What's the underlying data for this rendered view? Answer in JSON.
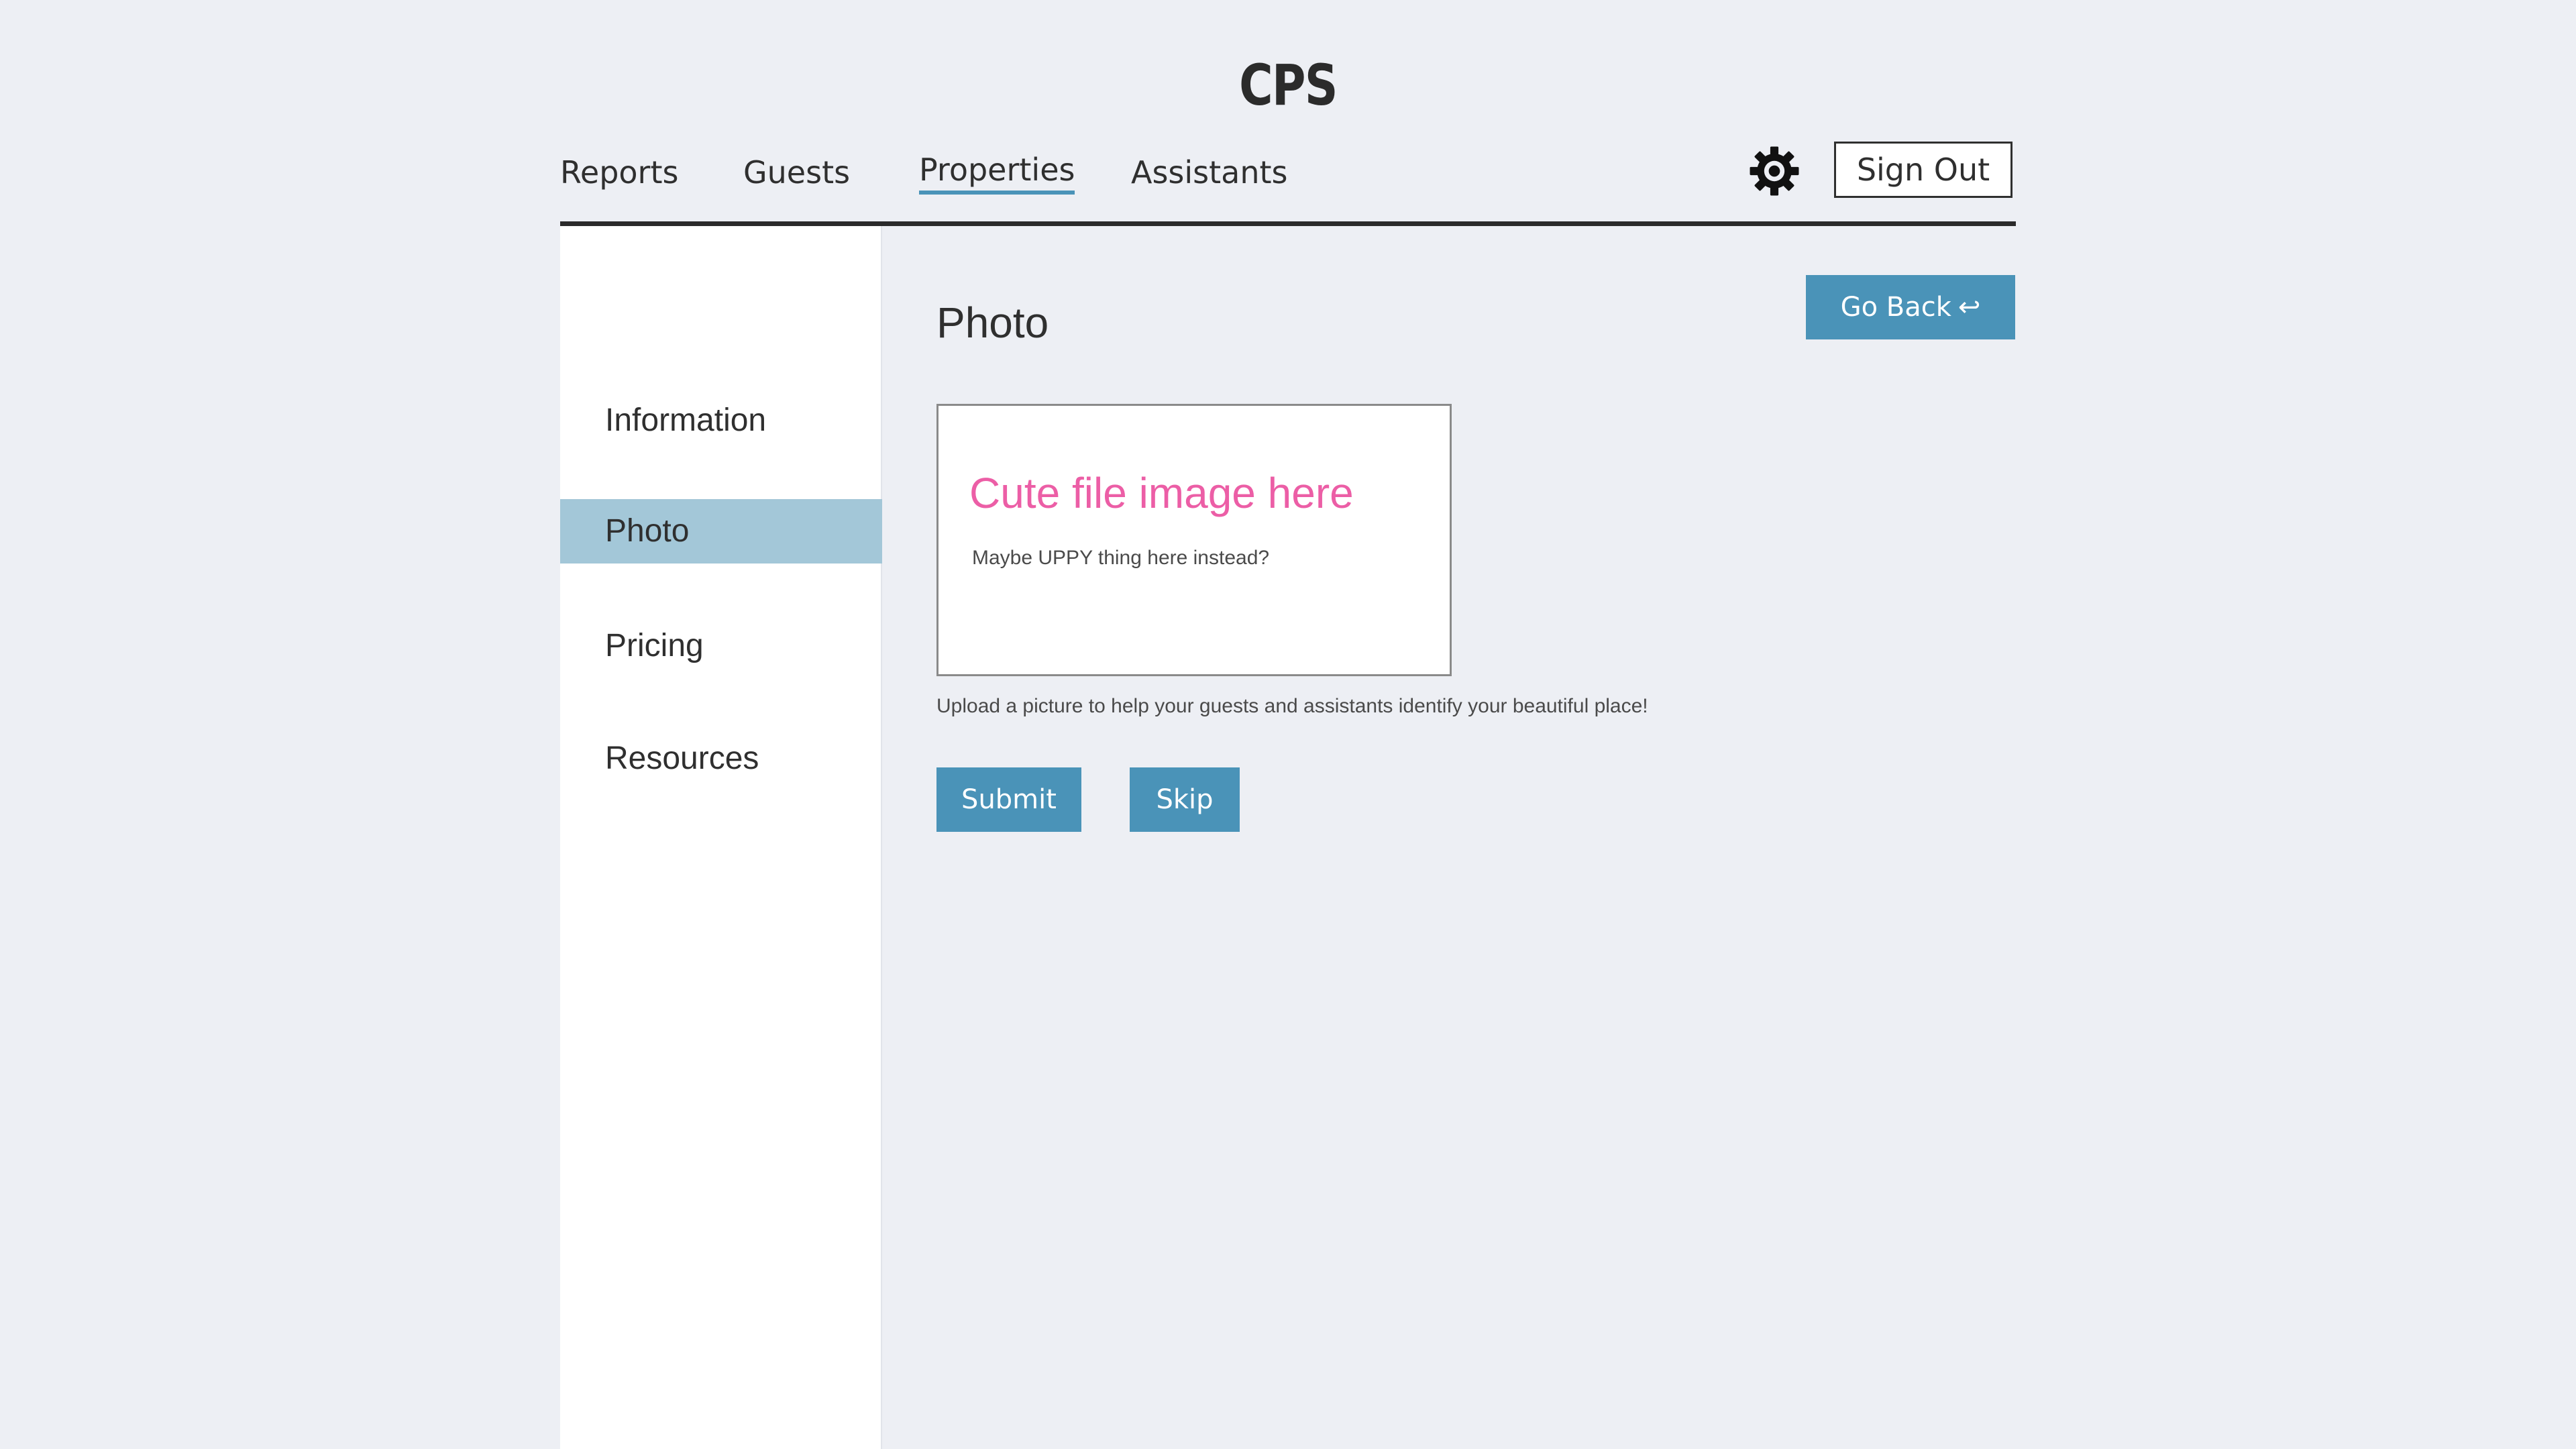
{
  "app": {
    "title": "CPS"
  },
  "nav": {
    "items": [
      {
        "label": "Reports"
      },
      {
        "label": "Guests"
      },
      {
        "label": "Properties",
        "active": true
      },
      {
        "label": "Assistants"
      }
    ],
    "settings_icon": "gear-icon",
    "sign_out_label": "Sign Out"
  },
  "sidebar": {
    "items": [
      {
        "label": "Information"
      },
      {
        "label": "Photo",
        "active": true
      },
      {
        "label": "Pricing"
      },
      {
        "label": "Resources"
      }
    ]
  },
  "main": {
    "title": "Photo",
    "go_back_label": "Go Back",
    "go_back_icon": "return-arrow-icon",
    "dropzone": {
      "title": "Cute file image here",
      "subtitle": "Maybe UPPY thing here instead?"
    },
    "help_text": "Upload a picture to help your guests and assistants identify your beautiful place!",
    "submit_label": "Submit",
    "skip_label": "Skip"
  },
  "colors": {
    "background": "#edeff4",
    "accent": "#4a93b8",
    "sidebar_active": "#a3c7d8",
    "dropzone_title": "#ec5ea6",
    "text": "#2f2f2f"
  }
}
